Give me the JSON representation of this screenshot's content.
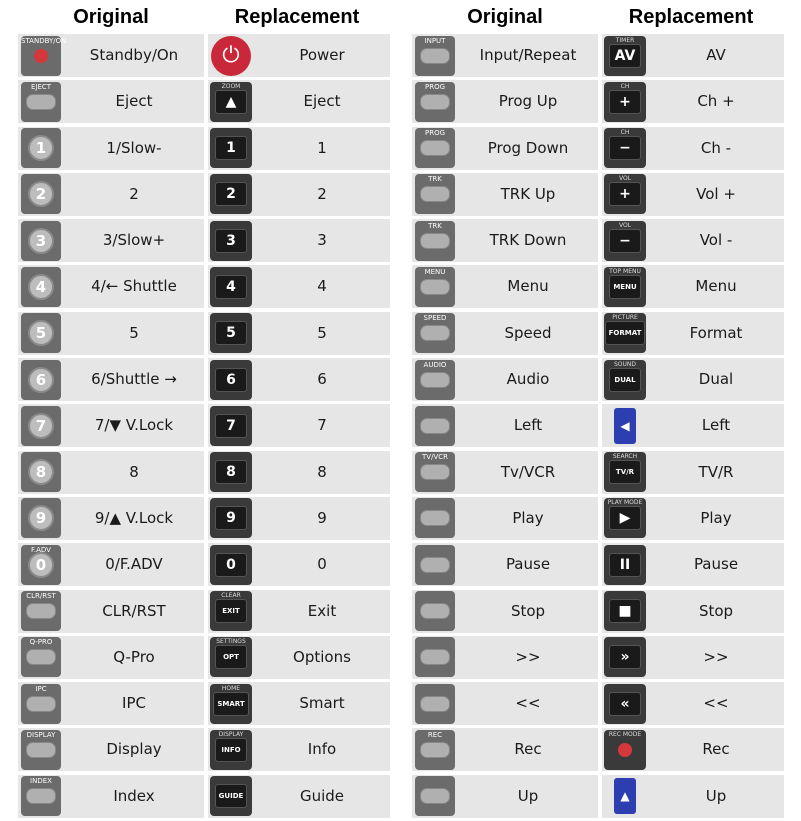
{
  "headers": {
    "original": "Original",
    "replacement": "Replacement"
  },
  "left": [
    {
      "o_icon": "standby-red-icon",
      "o_badge": "STANDBY/ON",
      "o": "Standby/On",
      "r_icon": "power-icon",
      "r_badge": "",
      "r": "Power"
    },
    {
      "o_icon": "eject-icon",
      "o_badge": "EJECT",
      "o": "Eject",
      "r_icon": "eject-icon",
      "r_badge": "ZOOM",
      "r": "Eject"
    },
    {
      "o_icon": "digit-1-icon",
      "o_key": "1",
      "o": "1/Slow-",
      "r_icon": "digit-1-icon",
      "r_key": "1",
      "r": "1"
    },
    {
      "o_icon": "digit-2-icon",
      "o_key": "2",
      "o": "2",
      "r_icon": "digit-2-icon",
      "r_key": "2",
      "r": "2"
    },
    {
      "o_icon": "digit-3-icon",
      "o_key": "3",
      "o": "3/Slow+",
      "r_icon": "digit-3-icon",
      "r_key": "3",
      "r": "3"
    },
    {
      "o_icon": "digit-4-icon",
      "o_key": "4",
      "o": "4/← Shuttle",
      "r_icon": "digit-4-icon",
      "r_key": "4",
      "r": "4"
    },
    {
      "o_icon": "digit-5-icon",
      "o_key": "5",
      "o": "5",
      "r_icon": "digit-5-icon",
      "r_key": "5",
      "r": "5"
    },
    {
      "o_icon": "digit-6-icon",
      "o_key": "6",
      "o": "6/Shuttle →",
      "r_icon": "digit-6-icon",
      "r_key": "6",
      "r": "6"
    },
    {
      "o_icon": "digit-7-icon",
      "o_key": "7",
      "o": "7/▼ V.Lock",
      "r_icon": "digit-7-icon",
      "r_key": "7",
      "r": "7"
    },
    {
      "o_icon": "digit-8-icon",
      "o_key": "8",
      "o": "8",
      "r_icon": "digit-8-icon",
      "r_key": "8",
      "r": "8"
    },
    {
      "o_icon": "digit-9-icon",
      "o_key": "9",
      "o": "9/▲ V.Lock",
      "r_icon": "digit-9-icon",
      "r_key": "9",
      "r": "9"
    },
    {
      "o_icon": "digit-0-icon",
      "o_key": "0",
      "o_badge": "F.ADV",
      "o": "0/F.ADV",
      "r_icon": "digit-0-icon",
      "r_key": "0",
      "r": "0"
    },
    {
      "o_icon": "clr-rst-icon",
      "o_badge": "CLR/RST",
      "o": "CLR/RST",
      "r_icon": "exit-icon",
      "r_badge": "CLEAR",
      "r_key": "EXIT",
      "r": "Exit"
    },
    {
      "o_icon": "q-pro-icon",
      "o_badge": "Q-PRO",
      "o": "Q-Pro",
      "r_icon": "opt-icon",
      "r_badge": "SETTINGS",
      "r_key": "OPT",
      "r": "Options"
    },
    {
      "o_icon": "ipc-icon",
      "o_badge": "IPC",
      "o": "IPC",
      "r_icon": "smart-icon",
      "r_badge": "HOME",
      "r_key": "SMART",
      "r": "Smart"
    },
    {
      "o_icon": "display-icon",
      "o_badge": "DISPLAY",
      "o": "Display",
      "r_icon": "info-icon",
      "r_badge": "DISPLAY",
      "r_key": "INFO",
      "r": "Info"
    },
    {
      "o_icon": "index-icon",
      "o_badge": "INDEX",
      "o": "Index",
      "r_icon": "guide-icon",
      "r_badge": "",
      "r_key": "GUIDE",
      "r": "Guide"
    }
  ],
  "right": [
    {
      "o_icon": "input-repeat-icon",
      "o_badge": "INPUT",
      "o": "Input/Repeat",
      "r_icon": "av-icon",
      "r_badge": "TIMER",
      "r_key": "AV",
      "r": "AV"
    },
    {
      "o_icon": "prog-up-icon",
      "o_badge": "PROG",
      "o": "Prog Up",
      "r_icon": "ch-plus-icon",
      "r_key": "+",
      "r_badge": "CH",
      "r": "Ch +"
    },
    {
      "o_icon": "prog-down-icon",
      "o_badge": "PROG",
      "o": "Prog Down",
      "r_icon": "ch-minus-icon",
      "r_key": "−",
      "r_badge": "CH",
      "r": "Ch -"
    },
    {
      "o_icon": "trk-up-icon",
      "o_badge": "TRK",
      "o": "TRK Up",
      "r_icon": "vol-plus-icon",
      "r_key": "+",
      "r_badge": "VOL",
      "r": "Vol +"
    },
    {
      "o_icon": "trk-down-icon",
      "o_badge": "TRK",
      "o": "TRK Down",
      "r_icon": "vol-minus-icon",
      "r_key": "−",
      "r_badge": "VOL",
      "r": "Vol -"
    },
    {
      "o_icon": "menu-icon",
      "o_badge": "MENU",
      "o": "Menu",
      "r_icon": "menu-icon",
      "r_badge": "TOP MENU",
      "r_key": "MENU",
      "r": "Menu"
    },
    {
      "o_icon": "speed-icon",
      "o_badge": "SPEED",
      "o": "Speed",
      "r_icon": "format-icon",
      "r_badge": "PICTURE",
      "r_key": "FORMAT",
      "r": "Format"
    },
    {
      "o_icon": "audio-icon",
      "o_badge": "AUDIO",
      "o": "Audio",
      "r_icon": "dual-icon",
      "r_badge": "SOUND",
      "r_key": "DUAL",
      "r": "Dual"
    },
    {
      "o_icon": "left-icon",
      "o_badge": "",
      "o": "Left",
      "r_icon": "left-arrow-icon",
      "r_badge": "",
      "r": "Left"
    },
    {
      "o_icon": "tv-vcr-icon",
      "o_badge": "TV/VCR",
      "o": "Tv/VCR",
      "r_icon": "tvr-icon",
      "r_badge": "SEARCH",
      "r_key": "TV/R",
      "r": "TV/R"
    },
    {
      "o_icon": "play-icon",
      "o_badge": "",
      "o": "Play",
      "r_icon": "play-icon",
      "r_badge": "PLAY MODE",
      "r_key": "▶",
      "r": "Play"
    },
    {
      "o_icon": "pause-icon",
      "o_badge": "",
      "o": "Pause",
      "r_icon": "pause-icon",
      "r_badge": "",
      "r_key": "II",
      "r": "Pause"
    },
    {
      "o_icon": "stop-icon",
      "o_badge": "",
      "o": "Stop",
      "r_icon": "stop-icon",
      "r_badge": "",
      "r_key": "■",
      "r": "Stop"
    },
    {
      "o_icon": "ff-icon",
      "o_badge": "",
      "o": ">>",
      "r_icon": "ff-icon",
      "r_badge": "",
      "r_key": "»",
      "r": ">>"
    },
    {
      "o_icon": "rew-icon",
      "o_badge": "",
      "o": "<<",
      "r_icon": "rew-icon",
      "r_badge": "",
      "r_key": "«",
      "r": "<<"
    },
    {
      "o_icon": "rec-icon",
      "o_badge": "REC",
      "o": "Rec",
      "r_icon": "rec-icon",
      "r_badge": "REC MODE",
      "r": "Rec"
    },
    {
      "o_icon": "up-icon",
      "o_badge": "",
      "o": "Up",
      "r_icon": "up-arrow-icon",
      "r_badge": "",
      "r": "Up"
    }
  ]
}
